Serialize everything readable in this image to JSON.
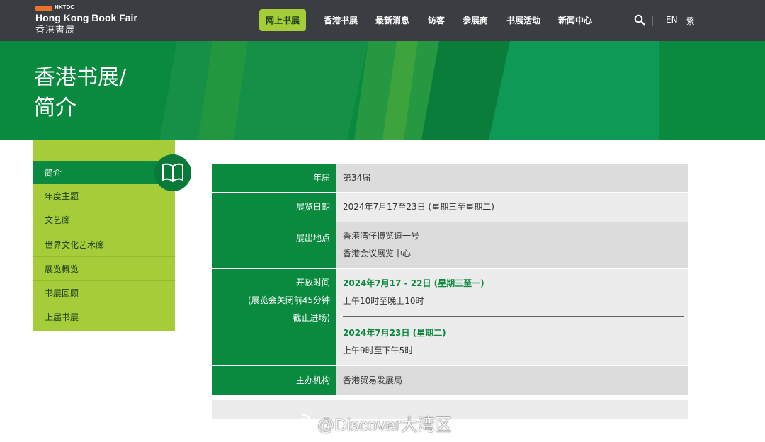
{
  "header": {
    "logo": {
      "org": "HKTDC",
      "name_en": "Hong Kong Book Fair",
      "name_zh": "香港書展"
    },
    "nav": {
      "online": "网上书展",
      "items": [
        "香港书展",
        "最新消息",
        "访客",
        "参展商",
        "书展活动",
        "新闻中心"
      ]
    },
    "lang_en": "EN",
    "lang_tc": "繁",
    "icons": {
      "search": "search-icon"
    }
  },
  "banner": {
    "title_line1": "香港书展/",
    "title_line2": "简介"
  },
  "sidebar": {
    "items": [
      "简介",
      "年度主题",
      "文艺廊",
      "世界文化艺术廊",
      "展览概览",
      "书展回顾",
      "上届书展"
    ],
    "active_index": 0,
    "badge_icon": "open-book-icon"
  },
  "info_table": {
    "rows": [
      {
        "label": "年届",
        "value": "第34届"
      },
      {
        "label": "展览日期",
        "value": "2024年7月17至23日 (星期三至星期二)"
      },
      {
        "label": "展出地点",
        "value_line1": "香港湾仔博览道一号",
        "value_line2": "香港会议展览中心"
      },
      {
        "label_line1": "开放时间",
        "label_line2": "(展览会关闭前45分钟",
        "label_line3": "截止进场)",
        "period1_dates": "2024年7月17 - 22日 (星期三至一)",
        "period1_hours": "上午10时至晚上10时",
        "period2_dates": "2024年7月23日 (星期二)",
        "period2_hours": "上午9时至下午5时"
      },
      {
        "label": "主办机构",
        "value": "香港贸易发展局"
      }
    ]
  },
  "watermark": {
    "text": "@Discover大湾区",
    "icon": "weibo-icon"
  },
  "colors": {
    "header_bg": "#3a3d42",
    "brand_green": "#0a8a3e",
    "lime": "#a4cd39",
    "logo_orange": "#e8722d"
  }
}
